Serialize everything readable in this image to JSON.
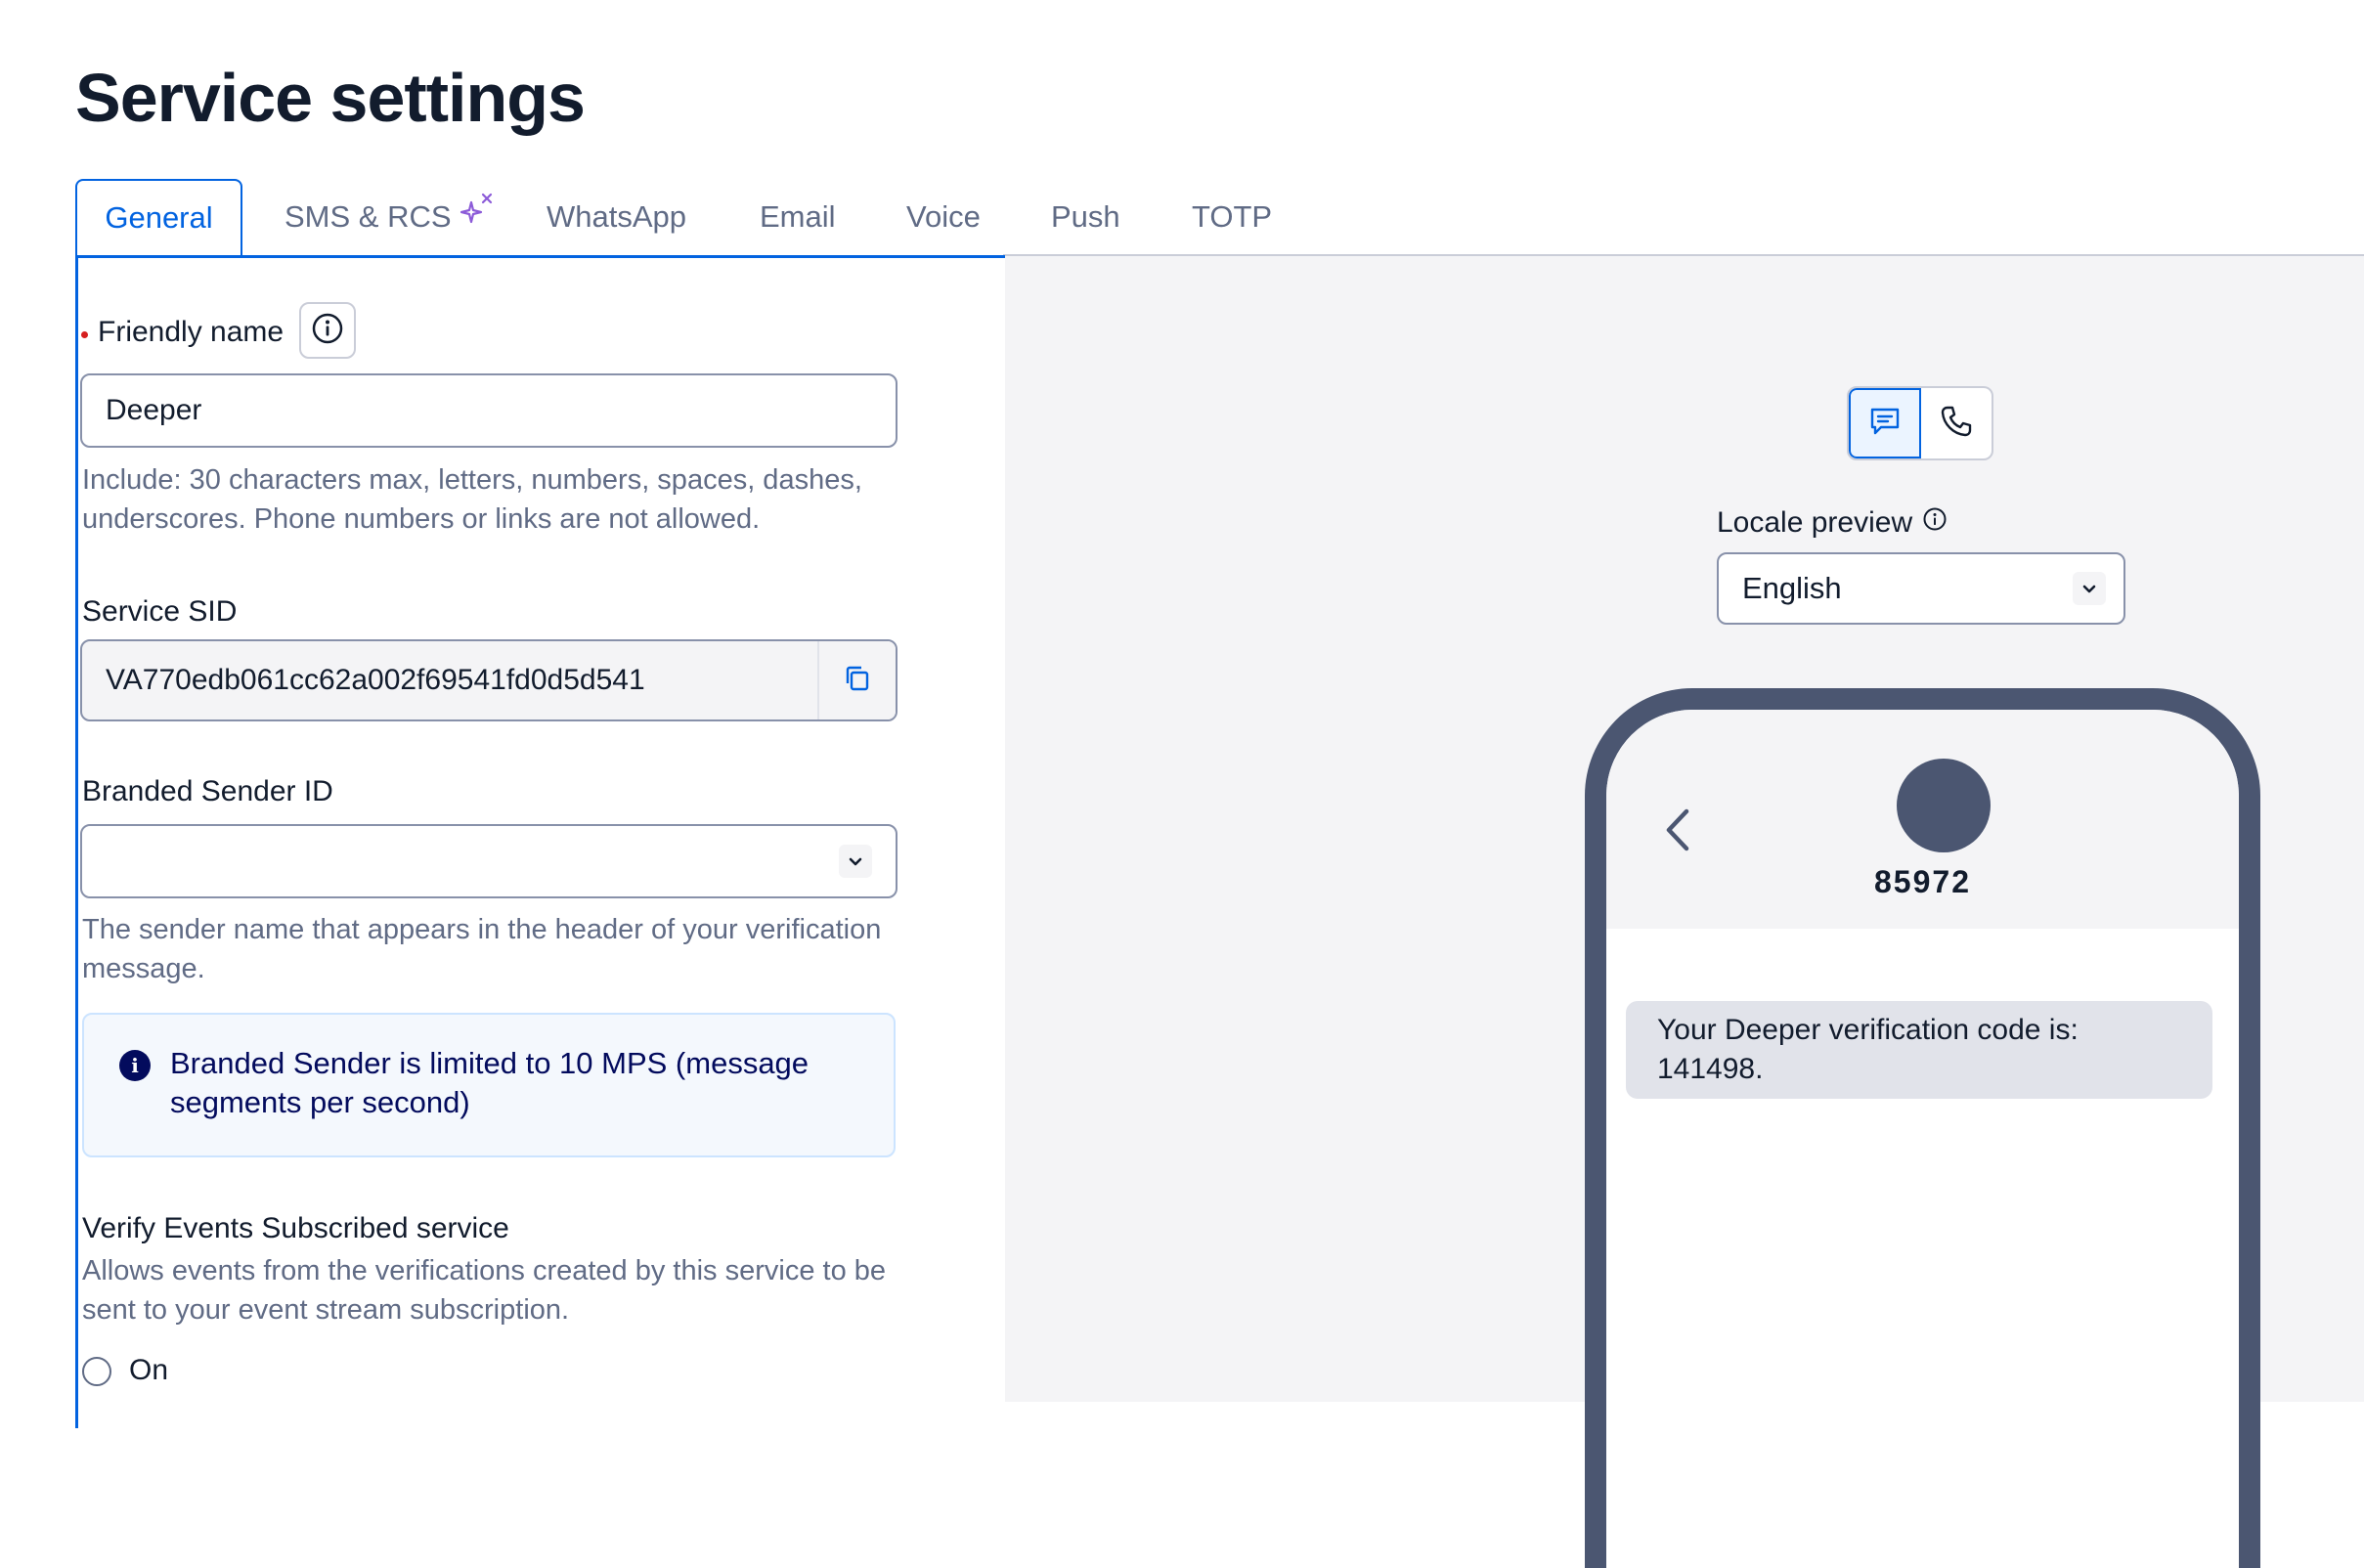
{
  "page": {
    "title": "Service settings"
  },
  "tabs": [
    {
      "label": "General",
      "active": true
    },
    {
      "label": "SMS & RCS",
      "icon": "sparkle-icon"
    },
    {
      "label": "WhatsApp"
    },
    {
      "label": "Email"
    },
    {
      "label": "Voice"
    },
    {
      "label": "Push"
    },
    {
      "label": "TOTP"
    }
  ],
  "form": {
    "friendly_name": {
      "label": "Friendly name",
      "value": "Deeper",
      "required": true,
      "help": "Include: 30 characters max, letters, numbers, spaces, dashes, underscores. Phone numbers or links are not allowed."
    },
    "service_sid": {
      "label": "Service SID",
      "value": "VA770edb061cc62a002f69541fd0d5d541"
    },
    "branded_sender": {
      "label": "Branded Sender ID",
      "value": "",
      "help": "The sender name that appears in the header of your verification message.",
      "callout": "Branded Sender is limited to 10 MPS (message segments per second)"
    },
    "verify_events": {
      "label": "Verify Events Subscribed service",
      "help": "Allows events from the verifications created by this service to be sent to your event stream subscription.",
      "option_on": "On"
    }
  },
  "preview": {
    "locale_label": "Locale preview",
    "locale_value": "English",
    "contact_number": "85972",
    "message": "Your Deeper verification code is: 141498."
  },
  "colors": {
    "accent": "#0263e0",
    "text": "#121c2d",
    "muted": "#606b85",
    "phone_frame": "#4b5671",
    "callout_bg": "#f4f8fd",
    "sparkle": "#8c5bd8"
  }
}
